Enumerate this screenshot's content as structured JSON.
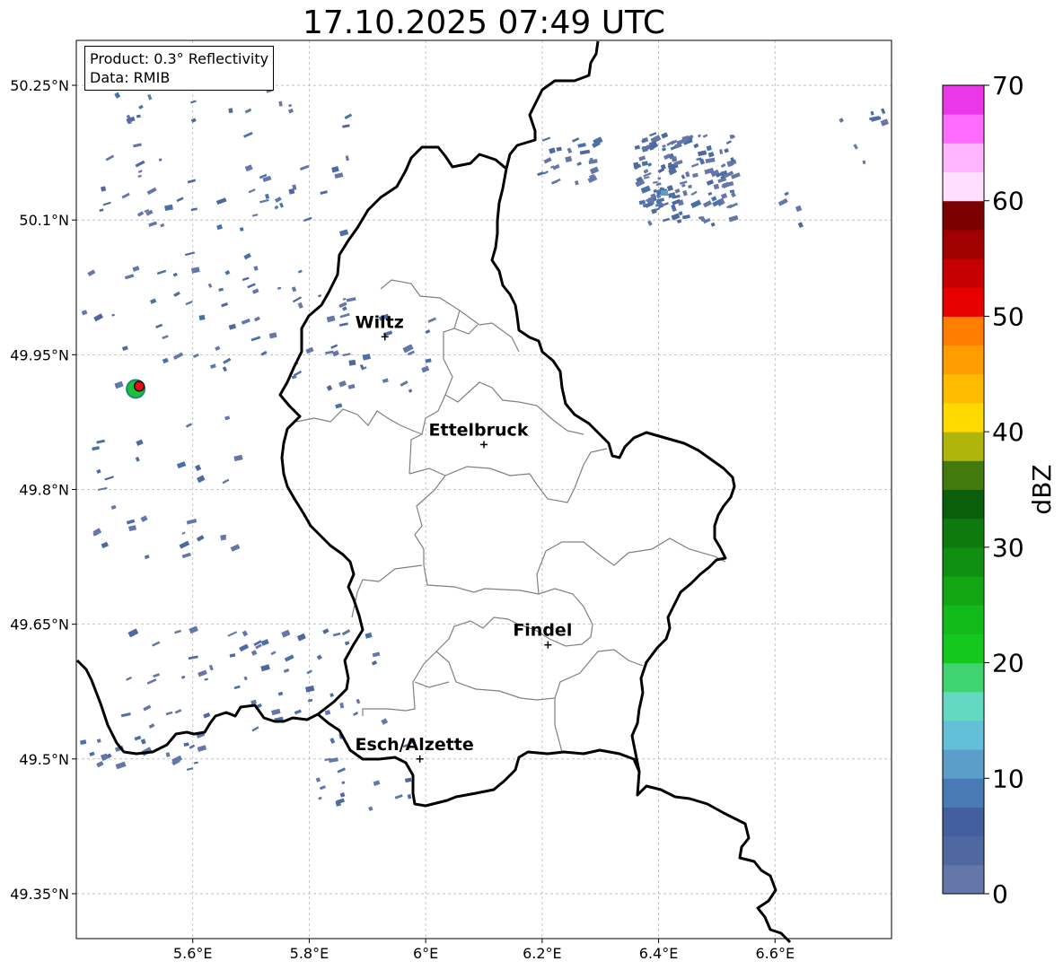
{
  "title": "17.10.2025 07:49 UTC",
  "info": {
    "product_line": "Product: 0.3° Reflectivity",
    "data_line": "Data: RMIB"
  },
  "axes": {
    "lon_range": [
      5.4,
      6.8
    ],
    "lat_range": [
      49.3,
      50.3
    ],
    "lon_ticks": [
      {
        "value": 5.6,
        "label": "5.6°E"
      },
      {
        "value": 5.8,
        "label": "5.8°E"
      },
      {
        "value": 6.0,
        "label": "6°E"
      },
      {
        "value": 6.2,
        "label": "6.2°E"
      },
      {
        "value": 6.4,
        "label": "6.4°E"
      },
      {
        "value": 6.6,
        "label": "6.6°E"
      }
    ],
    "lat_ticks": [
      {
        "value": 50.25,
        "label": "50.25°N"
      },
      {
        "value": 50.1,
        "label": "50.1°N"
      },
      {
        "value": 49.95,
        "label": "49.95°N"
      },
      {
        "value": 49.8,
        "label": "49.8°N"
      },
      {
        "value": 49.65,
        "label": "49.65°N"
      },
      {
        "value": 49.5,
        "label": "49.5°N"
      },
      {
        "value": 49.35,
        "label": "49.35°N"
      }
    ],
    "grid": true
  },
  "cities": [
    {
      "name": "Wiltz",
      "lon": 5.93,
      "lat": 49.97
    },
    {
      "name": "Ettelbruck",
      "lon": 6.1,
      "lat": 49.85
    },
    {
      "name": "Findel",
      "lon": 6.21,
      "lat": 49.627
    },
    {
      "name": "Esch/Alzette",
      "lon": 5.99,
      "lat": 49.5
    }
  ],
  "radar_site": {
    "lon": 5.505,
    "lat": 49.915
  },
  "colorbar": {
    "label": "dBZ",
    "min": 0,
    "max": 70,
    "ticks": [
      {
        "value": 0,
        "label": "0"
      },
      {
        "value": 10,
        "label": "10"
      },
      {
        "value": 20,
        "label": "20"
      },
      {
        "value": 30,
        "label": "30"
      },
      {
        "value": 40,
        "label": "40"
      },
      {
        "value": 50,
        "label": "50"
      },
      {
        "value": 60,
        "label": "60"
      },
      {
        "value": 70,
        "label": "70"
      }
    ],
    "colors": [
      "#6577a8",
      "#5068a0",
      "#435fa0",
      "#4a7ab5",
      "#5b9ec9",
      "#64bfd9",
      "#64d9c2",
      "#3fd46f",
      "#14c81d",
      "#12ba1a",
      "#12a615",
      "#108e12",
      "#0d7a10",
      "#0a5e0c",
      "#437a0e",
      "#b0b50b",
      "#ffd900",
      "#ffbb00",
      "#ff9c00",
      "#ff7e00",
      "#e60000",
      "#c60000",
      "#a00000",
      "#7c0000",
      "#ffdfff",
      "#ffb6ff",
      "#ff6bff",
      "#ea37ea"
    ]
  }
}
